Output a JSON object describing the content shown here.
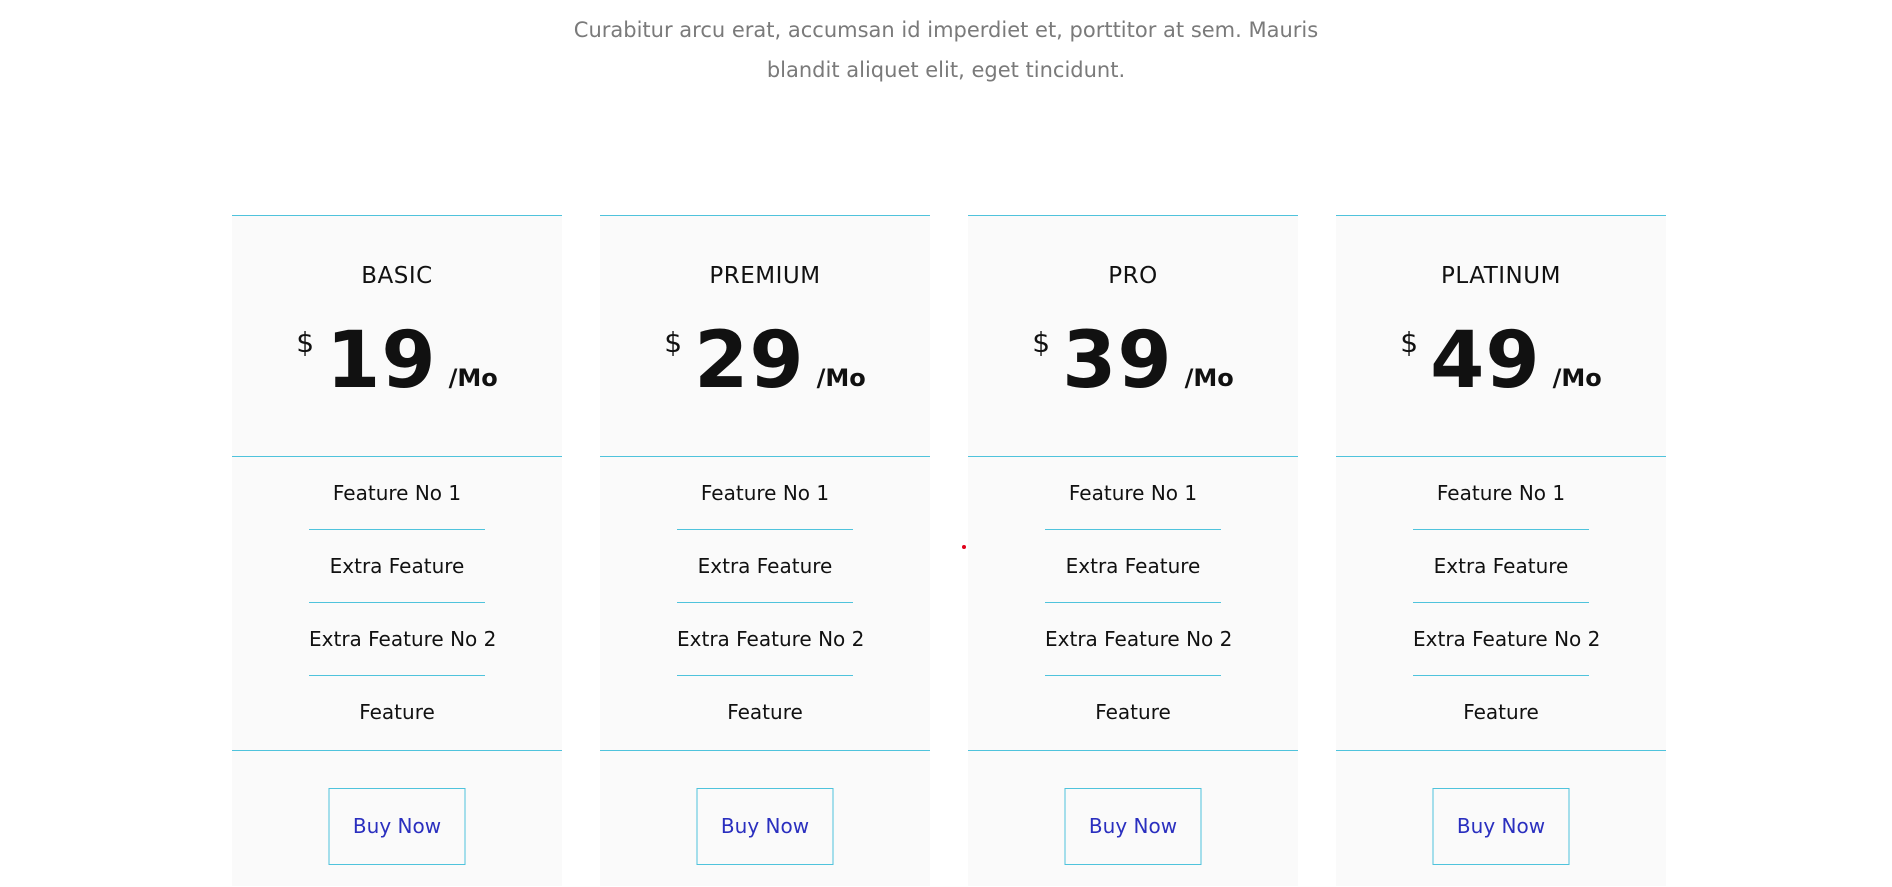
{
  "intro": {
    "line1": "Curabitur arcu erat, accumsan id imperdiet et, porttitor at sem. Mauris",
    "line2": "blandit aliquet elit, eget tincidunt."
  },
  "colors": {
    "accent_border": "#4fc3dc",
    "button_text": "#2a2fbf",
    "card_background": "#fafafa",
    "muted_text": "#7a7a7a",
    "marker_dot": "#e0001a"
  },
  "plans": [
    {
      "name": "BASIC",
      "currency": "$",
      "amount": "19",
      "period": "/Mo",
      "features": [
        "Feature No 1",
        "Extra Feature",
        "Extra Feature No 2",
        "Feature"
      ],
      "button_label": "Buy Now"
    },
    {
      "name": "PREMIUM",
      "currency": "$",
      "amount": "29",
      "period": "/Mo",
      "features": [
        "Feature No 1",
        "Extra Feature",
        "Extra Feature No 2",
        "Feature"
      ],
      "button_label": "Buy Now"
    },
    {
      "name": "PRO",
      "currency": "$",
      "amount": "39",
      "period": "/Mo",
      "features": [
        "Feature No 1",
        "Extra Feature",
        "Extra Feature No 2",
        "Feature"
      ],
      "button_label": "Buy Now"
    },
    {
      "name": "PLATINUM",
      "currency": "$",
      "amount": "49",
      "period": "/Mo",
      "features": [
        "Feature No 1",
        "Extra Feature",
        "Extra Feature No 2",
        "Feature"
      ],
      "button_label": "Buy Now"
    }
  ]
}
